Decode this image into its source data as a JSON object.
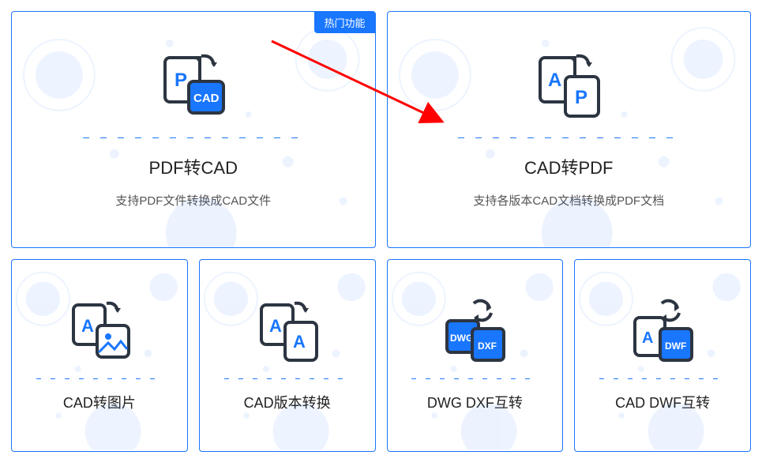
{
  "badge_label": "热门功能",
  "top_cards": [
    {
      "title": "PDF转CAD",
      "subtitle": "支持PDF文件转换成CAD文件"
    },
    {
      "title": "CAD转PDF",
      "subtitle": "支持各版本CAD文档转换成PDF文档"
    }
  ],
  "bottom_cards": [
    {
      "title": "CAD转图片"
    },
    {
      "title": "CAD版本转换"
    },
    {
      "title": "DWG DXF互转"
    },
    {
      "title": "CAD DWF互转"
    }
  ]
}
